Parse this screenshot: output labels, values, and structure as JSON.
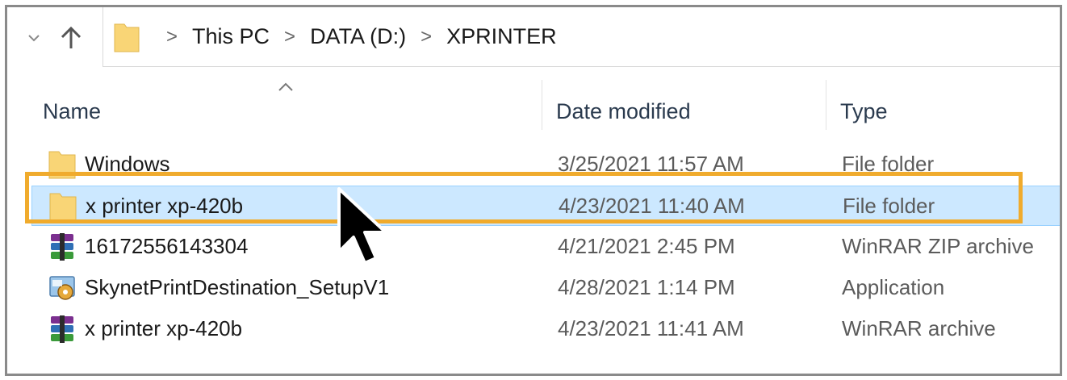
{
  "breadcrumb": {
    "items": [
      "This PC",
      "DATA (D:)",
      "XPRINTER"
    ],
    "separator": ">"
  },
  "columns": {
    "name": "Name",
    "date": "Date modified",
    "type": "Type"
  },
  "files": [
    {
      "name": "Windows",
      "date": "3/25/2021 11:57 AM",
      "type": "File folder",
      "icon": "folder-icon"
    },
    {
      "name": "x printer xp-420b",
      "date": "4/23/2021 11:40 AM",
      "type": "File folder",
      "icon": "folder-icon",
      "selected": true
    },
    {
      "name": "16172556143304",
      "date": "4/21/2021 2:45 PM",
      "type": "WinRAR ZIP archive",
      "icon": "winrar-archive-icon"
    },
    {
      "name": "SkynetPrintDestination_SetupV1",
      "date": "4/28/2021 1:14 PM",
      "type": "Application",
      "icon": "setup-application-icon"
    },
    {
      "name": "x printer xp-420b",
      "date": "4/23/2021 11:41 AM",
      "type": "WinRAR archive",
      "icon": "winrar-archive-icon"
    }
  ],
  "colors": {
    "selection": "#cce8ff",
    "highlight": "#f0ab2d",
    "folder": "#f9d576"
  },
  "icons": [
    "chevron-down-icon",
    "up-arrow-icon",
    "folder-icon",
    "winrar-archive-icon",
    "setup-application-icon",
    "sort-caret-icon",
    "mouse-cursor-icon"
  ]
}
